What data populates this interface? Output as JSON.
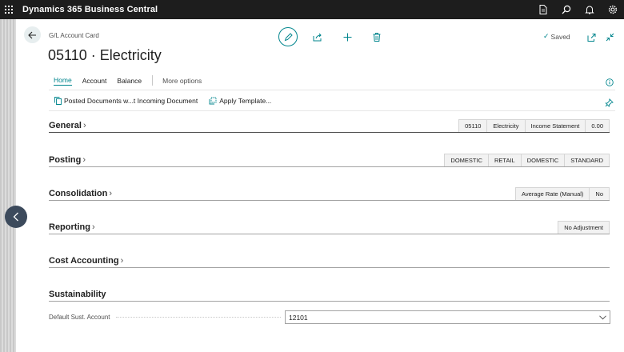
{
  "app": {
    "title": "Dynamics 365 Business Central",
    "icons": [
      "waffle-icon",
      "document-icon",
      "search-icon",
      "bell-icon",
      "gear-icon"
    ]
  },
  "header": {
    "breadcrumb": "G/L Account Card",
    "title": "05110 · Electricity",
    "saved_label": "Saved"
  },
  "tabs": [
    {
      "label": "Home",
      "active": true
    },
    {
      "label": "Account",
      "active": false
    },
    {
      "label": "Balance",
      "active": false
    },
    {
      "label": "More options",
      "active": false
    }
  ],
  "actions": [
    {
      "label": "Posted Documents w...t Incoming Document",
      "icon": "copy-icon"
    },
    {
      "label": "Apply Template...",
      "icon": "template-icon"
    }
  ],
  "sections": {
    "general": {
      "label": "General",
      "bubbles": [
        "05110",
        "Electricity",
        "Income Statement",
        "0.00"
      ]
    },
    "posting": {
      "label": "Posting",
      "bubbles": [
        "DOMESTIC",
        "RETAIL",
        "DOMESTIC",
        "STANDARD"
      ]
    },
    "consolidation": {
      "label": "Consolidation",
      "bubbles": [
        "Average Rate (Manual)",
        "No"
      ]
    },
    "reporting": {
      "label": "Reporting",
      "bubbles": [
        "No Adjustment"
      ]
    },
    "cost_accounting": {
      "label": "Cost Accounting",
      "bubbles": []
    },
    "sustainability": {
      "label": "Sustainability",
      "field_label": "Default Sust. Account",
      "field_value": "12101"
    }
  },
  "colors": {
    "accent": "#00858d",
    "appbar": "#1d1d1d",
    "nav": "#3c4a5c"
  }
}
